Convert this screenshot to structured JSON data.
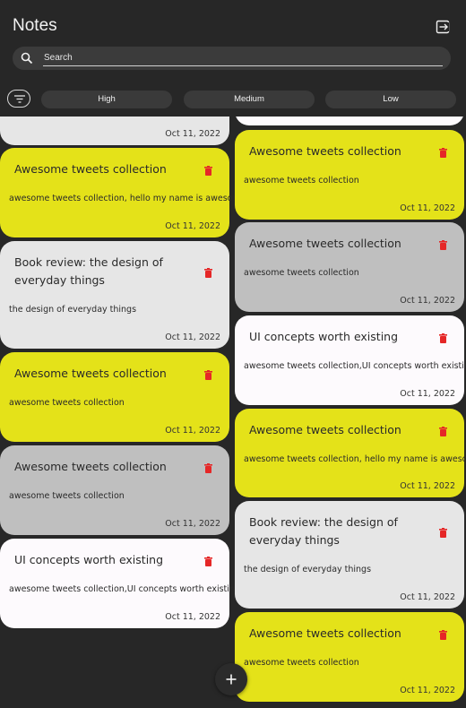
{
  "app": {
    "title": "Notes"
  },
  "search": {
    "placeholder": "Search"
  },
  "filters": {
    "chips": [
      "High",
      "Medium",
      "Low"
    ]
  },
  "colors": {
    "background": "#272727",
    "yellow": "#e4e219",
    "light": "#e6e6e6",
    "gray": "#bfbfbf",
    "white": "#fdfafd",
    "trash": "#e52727"
  },
  "notes": {
    "left": [
      {
        "title": "",
        "body": "",
        "date": "Oct 11, 2022",
        "color": "light"
      },
      {
        "title": "Awesome tweets collection",
        "body": "awesome tweets collection, hello my name is awesome",
        "date": "Oct 11, 2022",
        "color": "yellow"
      },
      {
        "title": "Book review: the design of everyday things",
        "body": "the design of everyday things",
        "date": "Oct 11, 2022",
        "color": "light"
      },
      {
        "title": "Awesome tweets collection",
        "body": "awesome tweets collection",
        "date": "Oct 11, 2022",
        "color": "yellow"
      },
      {
        "title": "Awesome tweets collection",
        "body": "awesome tweets collection",
        "date": "Oct 11, 2022",
        "color": "gray"
      },
      {
        "title": "UI concepts worth existing",
        "body": "awesome tweets collection,UI concepts worth existing",
        "date": "Oct 11, 2022",
        "color": "white"
      }
    ],
    "right": [
      {
        "title": "",
        "body": "",
        "date": "",
        "color": "white"
      },
      {
        "title": "Awesome tweets collection",
        "body": "awesome tweets collection",
        "date": "Oct 11, 2022",
        "color": "yellow"
      },
      {
        "title": "Awesome tweets collection",
        "body": "awesome tweets collection",
        "date": "Oct 11, 2022",
        "color": "gray"
      },
      {
        "title": "UI concepts worth existing",
        "body": "awesome tweets collection,UI concepts worth existing",
        "date": "Oct 11, 2022",
        "color": "white"
      },
      {
        "title": "Awesome tweets collection",
        "body": "awesome tweets collection, hello my name is awesome",
        "date": "Oct 11, 2022",
        "color": "yellow"
      },
      {
        "title": "Book review: the design of everyday things",
        "body": "the design of everyday things",
        "date": "Oct 11, 2022",
        "color": "light"
      },
      {
        "title": "Awesome tweets collection",
        "body": "awesome tweets collection",
        "date": "Oct 11, 2022",
        "color": "yellow"
      }
    ]
  },
  "icons": {
    "logout": "logout-icon",
    "search": "search-icon",
    "filter": "filter-icon",
    "delete": "trash-icon",
    "add": "plus-icon"
  }
}
